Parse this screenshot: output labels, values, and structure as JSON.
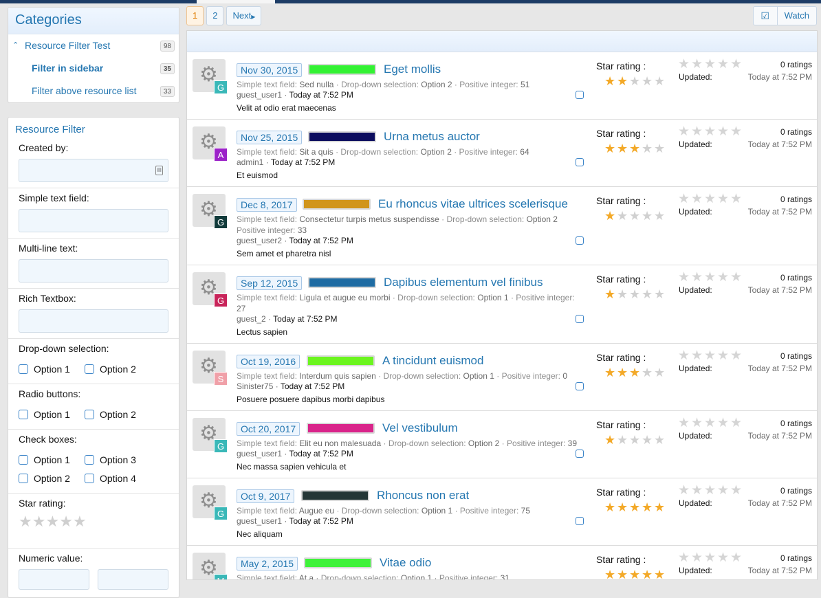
{
  "categories": {
    "title": "Categories",
    "items": [
      {
        "label": "Resource Filter Test",
        "count": "98"
      },
      {
        "label": "Filter in sidebar",
        "count": "35"
      },
      {
        "label": "Filter above resource list",
        "count": "33"
      }
    ]
  },
  "filter": {
    "title": "Resource Filter",
    "created_by": "Created by:",
    "simple_text": "Simple text field:",
    "multiline": "Multi-line text:",
    "rich": "Rich Textbox:",
    "dropdown": {
      "label": "Drop-down selection:",
      "options": [
        "Option 1",
        "Option 2"
      ]
    },
    "radio": {
      "label": "Radio buttons:",
      "options": [
        "Option 1",
        "Option 2"
      ]
    },
    "checks": {
      "label": "Check boxes:",
      "options": [
        "Option 1",
        "Option 3",
        "Option 2",
        "Option 4"
      ]
    },
    "star": "Star rating:",
    "numeric": "Numeric value:"
  },
  "pager": {
    "pages": [
      "1",
      "2"
    ],
    "next": "Next"
  },
  "watch": {
    "label": "Watch",
    "icon": "check-square-icon"
  },
  "resources": [
    {
      "date": "Nov 30, 2015",
      "color": "#33f233",
      "title": "Eget mollis",
      "meta_l1": [
        [
          "Simple text field:",
          "Sed nulla"
        ],
        [
          "Drop-down selection:",
          "Option 2"
        ],
        [
          "Positive integer:",
          "51"
        ]
      ],
      "meta_l2": [],
      "user": "guest_user1",
      "time": "Today at 7:52 PM",
      "snippet": "Velit at odio erat maecenas",
      "avatar_letter": "G",
      "avatar_color": "#3ab8b8",
      "stars": 2
    },
    {
      "date": "Nov 25, 2015",
      "color": "#0c0d5e",
      "title": "Urna metus auctor",
      "meta_l1": [
        [
          "Simple text field:",
          "Sit a quis"
        ],
        [
          "Drop-down selection:",
          "Option 2"
        ],
        [
          "Positive integer:",
          "64"
        ]
      ],
      "meta_l2": [],
      "user": "admin1",
      "time": "Today at 7:52 PM",
      "snippet": "Et euismod",
      "avatar_letter": "A",
      "avatar_color": "#9b22c8",
      "stars": 3
    },
    {
      "date": "Dec 8, 2017",
      "color": "#d1951b",
      "title": "Eu rhoncus vitae ultrices scelerisque",
      "meta_l1": [
        [
          "Simple text field:",
          "Consectetur turpis metus suspendisse"
        ],
        [
          "Drop-down selection:",
          "Option 2"
        ]
      ],
      "meta_l2": [
        [
          "Positive integer:",
          "33"
        ]
      ],
      "user": "guest_user2",
      "time": "Today at 7:52 PM",
      "snippet": "Sem amet et pharetra nisl",
      "avatar_letter": "G",
      "avatar_color": "#123b3b",
      "stars": 1
    },
    {
      "date": "Sep 12, 2015",
      "color": "#1f6ca3",
      "title": "Dapibus elementum vel finibus",
      "meta_l1": [
        [
          "Simple text field:",
          "Ligula et augue eu morbi"
        ],
        [
          "Drop-down selection:",
          "Option 1"
        ],
        [
          "Positive integer:",
          ""
        ]
      ],
      "meta_l2": [
        [
          "",
          "27"
        ]
      ],
      "user": "guest_2",
      "time": "Today at 7:52 PM",
      "snippet": "Lectus sapien",
      "avatar_letter": "G",
      "avatar_color": "#c8245a",
      "stars": 1
    },
    {
      "date": "Oct 19, 2016",
      "color": "#6cf51f",
      "title": "A tincidunt euismod",
      "meta_l1": [
        [
          "Simple text field:",
          "Interdum quis sapien"
        ],
        [
          "Drop-down selection:",
          "Option 1"
        ],
        [
          "Positive integer:",
          "0"
        ]
      ],
      "meta_l2": [],
      "user": "Sinister75",
      "time": "Today at 7:52 PM",
      "snippet": "Posuere posuere dapibus morbi dapibus",
      "avatar_letter": "S",
      "avatar_color": "#f0a0a8",
      "stars": 3
    },
    {
      "date": "Oct 20, 2017",
      "color": "#d9248a",
      "title": "Vel vestibulum",
      "meta_l1": [
        [
          "Simple text field:",
          "Elit eu non malesuada"
        ],
        [
          "Drop-down selection:",
          "Option 2"
        ],
        [
          "Positive integer:",
          "39"
        ]
      ],
      "meta_l2": [],
      "user": "guest_user1",
      "time": "Today at 7:52 PM",
      "snippet": "Nec massa sapien vehicula et",
      "avatar_letter": "G",
      "avatar_color": "#3ab8b8",
      "stars": 1
    },
    {
      "date": "Oct 9, 2017",
      "color": "#243636",
      "title": "Rhoncus non erat",
      "meta_l1": [
        [
          "Simple text field:",
          "Augue eu"
        ],
        [
          "Drop-down selection:",
          "Option 1"
        ],
        [
          "Positive integer:",
          "75"
        ]
      ],
      "meta_l2": [],
      "user": "guest_user1",
      "time": "Today at 7:52 PM",
      "snippet": "Nec aliquam",
      "avatar_letter": "G",
      "avatar_color": "#3ab8b8",
      "stars": 5
    },
    {
      "date": "May 2, 2015",
      "color": "#3ff23a",
      "title": "Vitae odio",
      "meta_l1": [
        [
          "Simple text field:",
          "At a"
        ],
        [
          "Drop-down selection:",
          "Option 1"
        ],
        [
          "Positive integer:",
          "31"
        ]
      ],
      "meta_l2": [],
      "user": "",
      "time": "",
      "snippet": "",
      "avatar_letter": "M",
      "avatar_color": "#3ab8b8",
      "stars": 5
    }
  ],
  "labels": {
    "star_rating": "Star rating :",
    "updated": "Updated:",
    "ratings": "0 ratings",
    "updated_time": "Today at 7:52 PM"
  }
}
